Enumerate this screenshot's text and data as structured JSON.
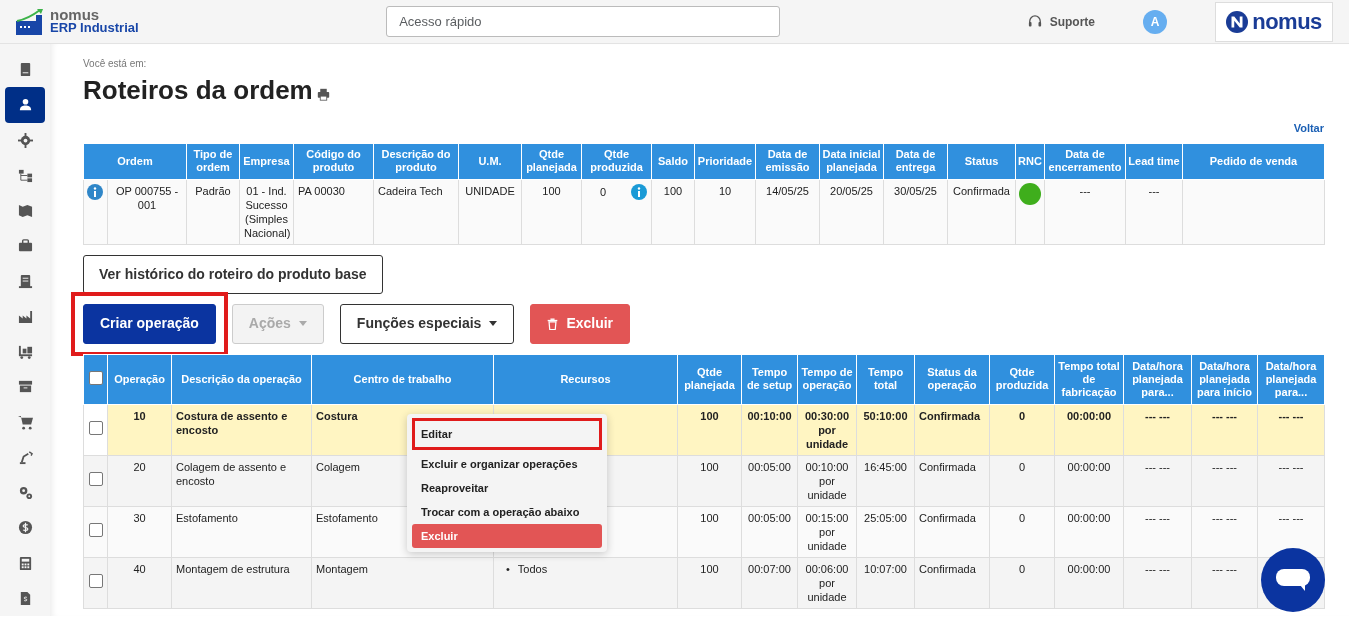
{
  "header": {
    "logo_title": "nomus",
    "logo_subtitle": "ERP Industrial",
    "search": {
      "placeholder": "Acesso rápido"
    },
    "support": "Suporte",
    "avatar": "A",
    "brand": "nomus"
  },
  "sidebar": {
    "items": [
      {
        "kind": "book",
        "selected": false
      },
      {
        "kind": "person",
        "selected": true
      },
      {
        "kind": "gear",
        "selected": false
      },
      {
        "kind": "hierarchy",
        "selected": false
      },
      {
        "kind": "map",
        "selected": false
      },
      {
        "kind": "briefcase",
        "selected": false
      },
      {
        "kind": "document",
        "selected": false
      },
      {
        "kind": "factory",
        "selected": false
      },
      {
        "kind": "cart-flat",
        "selected": false
      },
      {
        "kind": "archive",
        "selected": false
      },
      {
        "kind": "cart",
        "selected": false
      },
      {
        "kind": "robot",
        "selected": false
      },
      {
        "kind": "gears",
        "selected": false
      },
      {
        "kind": "dollar",
        "selected": false
      },
      {
        "kind": "calculator",
        "selected": false
      },
      {
        "kind": "invoice",
        "selected": false
      }
    ]
  },
  "breadcrumb_label": "Você está em:",
  "page_title": "Roteiros da ordem",
  "back_link": "Voltar",
  "order_table": {
    "columns": [
      "Ordem",
      "Tipo de ordem",
      "Empresa",
      "Código do produto",
      "Descrição do produto",
      "U.M.",
      "Qtde planejada",
      "Qtde produzida",
      "Saldo",
      "Prioridade",
      "Data de emissão",
      "Data inicial planejada",
      "Data de entrega",
      "Status",
      "RNC",
      "Data de encerramento",
      "Lead time",
      "Pedido de venda"
    ],
    "rows": [
      {
        "ordem": "OP 000755 - 001",
        "tipo": "Padrão",
        "empresa": "01 - Ind. Sucesso (Simples Nacional)",
        "codigo": "PA 00030",
        "descricao": "Cadeira Tech",
        "um": "UNIDADE",
        "qtde_planejada": "100",
        "qtde_produzida": "0",
        "saldo": "100",
        "prioridade": "10",
        "emissao": "14/05/25",
        "inicial": "20/05/25",
        "entrega": "30/05/25",
        "status": "Confirmada",
        "rnc": {
          "color": "#3fae1c"
        },
        "encerramento": "---",
        "lead_time": "---"
      }
    ]
  },
  "history_button": "Ver histórico do roteiro do produto base",
  "toolbar": [
    {
      "label": "Criar operação",
      "kind": "primary",
      "highlighted": true,
      "disabled": false
    },
    {
      "label": "Ações",
      "kind": "dropdown",
      "highlighted": false,
      "disabled": true
    },
    {
      "label": "Funções especiais",
      "kind": "dropdown",
      "highlighted": false,
      "disabled": false
    },
    {
      "label": "Excluir",
      "kind": "danger",
      "highlighted": false,
      "disabled": false
    }
  ],
  "operations_table": {
    "header_checked": false,
    "columns": [
      "Operação",
      "Descrição da operação",
      "Centro de trabalho",
      "Recursos",
      "Qtde planejada",
      "Tempo de setup",
      "Tempo de operação",
      "Tempo total",
      "Status da operação",
      "Qtde produzida",
      "Tempo total de fabricação",
      "Data/hora planejada para...",
      "Data/hora planejada para início",
      "Data/hora planejada para..."
    ],
    "rows": [
      {
        "checked": false,
        "selected": true,
        "operacao": "10",
        "descricao": "Costura de assento e encosto",
        "centro": "Costura",
        "qtde": "100",
        "setup": "00:10:00",
        "tempo_op": "00:30:00 por unidade",
        "total": "50:10:00",
        "status": "Confirmada",
        "produzida": "0",
        "fabricacao": "00:00:00",
        "dh1": "--- ---",
        "dh2": "--- ---",
        "dh3": "--- ---"
      },
      {
        "checked": false,
        "selected": false,
        "operacao": "20",
        "descricao": "Colagem de assento e encosto",
        "centro": "Colagem",
        "qtde": "100",
        "setup": "00:05:00",
        "tempo_op": "00:10:00 por unidade",
        "total": "16:45:00",
        "status": "Confirmada",
        "produzida": "0",
        "fabricacao": "00:00:00",
        "dh1": "--- ---",
        "dh2": "--- ---",
        "dh3": "--- ---"
      },
      {
        "checked": false,
        "selected": false,
        "operacao": "30",
        "descricao": "Estofamento",
        "centro": "Estofamento",
        "qtde": "100",
        "setup": "00:05:00",
        "tempo_op": "00:15:00 por unidade",
        "total": "25:05:00",
        "status": "Confirmada",
        "produzida": "0",
        "fabricacao": "00:00:00",
        "dh1": "--- ---",
        "dh2": "--- ---",
        "dh3": "--- ---"
      },
      {
        "checked": false,
        "selected": false,
        "operacao": "40",
        "descricao": "Montagem de estrutura",
        "centro": "Montagem",
        "recursos": [
          {
            "bullet": "•",
            "label": "Todos"
          }
        ],
        "qtde": "100",
        "setup": "00:07:00",
        "tempo_op": "00:06:00 por unidade",
        "total": "10:07:00",
        "status": "Confirmada",
        "produzida": "0",
        "fabricacao": "00:00:00",
        "dh1": "--- ---",
        "dh2": "--- ---"
      }
    ]
  },
  "context_menu": [
    {
      "label": "Editar",
      "kind": "normal",
      "highlighted": true
    },
    {
      "label": "Excluir e organizar operações",
      "kind": "normal",
      "highlighted": false
    },
    {
      "label": "Reaproveitar",
      "kind": "normal",
      "highlighted": false
    },
    {
      "label": "Trocar com a operação abaixo",
      "kind": "normal",
      "highlighted": false
    },
    {
      "label": "Excluir",
      "kind": "danger",
      "highlighted": false
    }
  ]
}
